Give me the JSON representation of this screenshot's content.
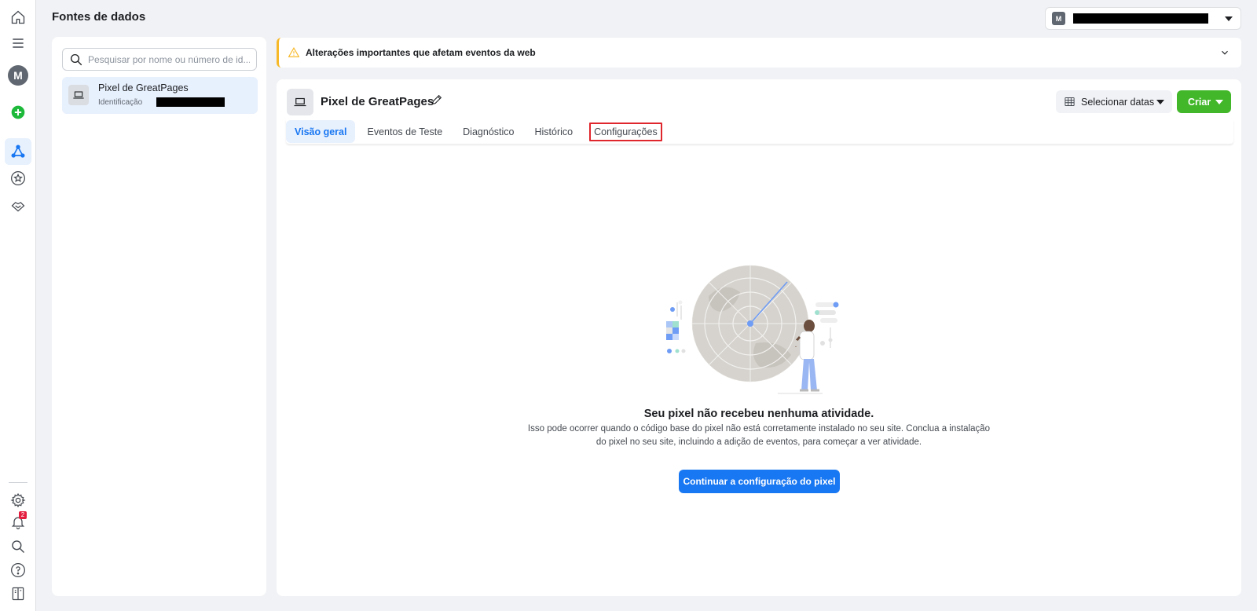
{
  "header": {
    "title": "Fontes de dados",
    "account_initial": "M"
  },
  "rail": {
    "avatar_initial": "M",
    "notification_count": "2"
  },
  "sidebar": {
    "search_placeholder": "Pesquisar por nome ou número de id...",
    "items": [
      {
        "name": "Pixel de GreatPages",
        "id_label": "Identificação"
      }
    ]
  },
  "banner": {
    "text": "Alterações importantes que afetam eventos da web"
  },
  "main": {
    "title": "Pixel de GreatPages",
    "date_button": "Selecionar datas",
    "create_button": "Criar",
    "tabs": [
      {
        "label": "Visão geral",
        "active": true
      },
      {
        "label": "Eventos de Teste"
      },
      {
        "label": "Diagnóstico"
      },
      {
        "label": "Histórico"
      },
      {
        "label": "Configurações",
        "highlighted": true
      }
    ],
    "empty_title": "Seu pixel não recebeu nenhuma atividade.",
    "empty_desc_line1": "Isso pode ocorrer quando o código base do pixel não está corretamente instalado no seu site. Conclua a instalação",
    "empty_desc_line2": "do pixel no seu site, incluindo a adição de eventos, para começar a ver atividade.",
    "cta_button": "Continuar a configuração do pixel"
  },
  "colors": {
    "primary": "#1877f2",
    "create_green": "#42b72a",
    "warning": "#f7b928",
    "highlight_red": "#e0262d",
    "background": "#f0f2f5"
  }
}
